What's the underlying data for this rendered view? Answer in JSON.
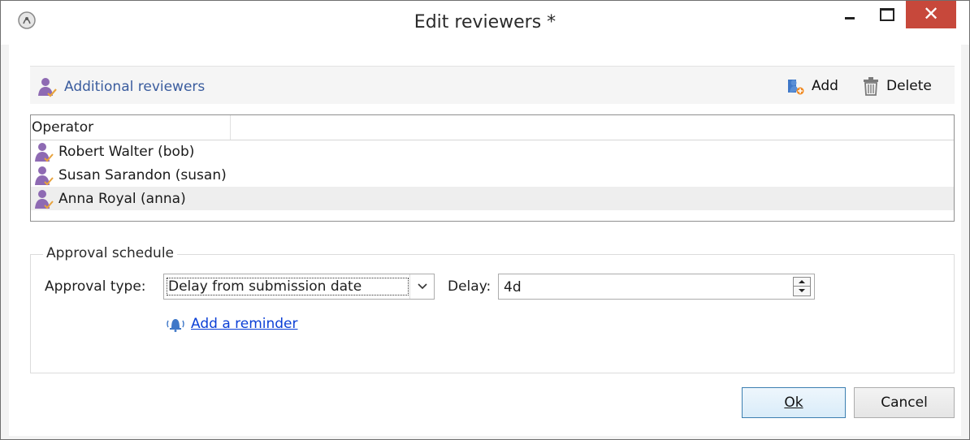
{
  "window": {
    "title": "Edit reviewers *",
    "controls": {
      "minimize": "minimize",
      "maximize": "maximize",
      "close": "✕"
    }
  },
  "toolbar": {
    "title": "Additional reviewers",
    "add_label": "Add",
    "delete_label": "Delete"
  },
  "list": {
    "column_header": "Operator",
    "rows": [
      {
        "label": "Robert Walter (bob)",
        "selected": false
      },
      {
        "label": "Susan Sarandon (susan)",
        "selected": false
      },
      {
        "label": "Anna Royal (anna)",
        "selected": true
      }
    ]
  },
  "schedule": {
    "legend": "Approval schedule",
    "approval_type_label": "Approval type:",
    "approval_type_value": "Delay from submission date",
    "delay_label": "Delay:",
    "delay_value": "4d",
    "reminder_link": "Add a reminder"
  },
  "buttons": {
    "ok_label": "Ok",
    "cancel_label": "Cancel"
  },
  "colors": {
    "accent_link": "#0b3fd6",
    "toolbar_title": "#3a5c9e",
    "close_button": "#c7483b",
    "user_icon": "#8e6ab3",
    "check_mark": "#e8a33d",
    "reminder_icon": "#3f78c8"
  },
  "icons": {
    "app": "app-icon",
    "reviewers": "user-check-icon",
    "add": "add-user-icon",
    "delete": "trash-icon",
    "reminder": "bell-icon"
  }
}
